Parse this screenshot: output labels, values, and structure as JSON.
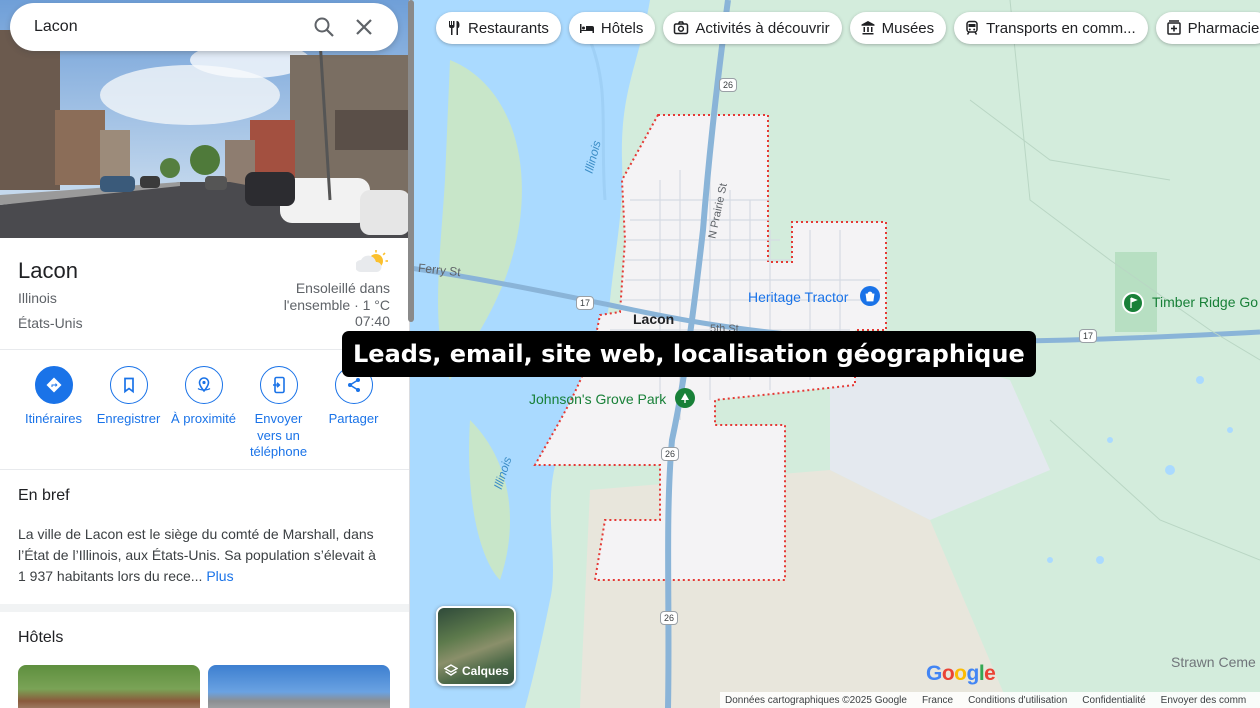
{
  "search": {
    "value": "Lacon"
  },
  "place": {
    "name": "Lacon",
    "state": "Illinois",
    "country": "États-Unis",
    "weather_line1": "Ensoleillé dans",
    "weather_line2": "l'ensemble · 1 °C",
    "time": "07:40"
  },
  "actions": [
    {
      "label": "Itinéraires",
      "icon": "directions-icon"
    },
    {
      "label": "Enregistrer",
      "icon": "bookmark-icon"
    },
    {
      "label": "À proximité",
      "icon": "nearby-icon"
    },
    {
      "label": "Envoyer vers un téléphone",
      "icon": "send-to-phone-icon"
    },
    {
      "label": "Partager",
      "icon": "share-icon"
    }
  ],
  "overview": {
    "title": "En bref",
    "text": "La ville de Lacon est le siège du comté de Marshall, dans l’État de l’Illinois, aux États-Unis. Sa population s’élevait à 1 937 habitants lors du rece...",
    "more": "Plus"
  },
  "hotels": {
    "title": "Hôtels"
  },
  "chips": [
    {
      "label": "Restaurants",
      "icon": "restaurant-icon"
    },
    {
      "label": "Hôtels",
      "icon": "bed-icon"
    },
    {
      "label": "Activités à découvrir",
      "icon": "camera-icon"
    },
    {
      "label": "Musées",
      "icon": "museum-icon"
    },
    {
      "label": "Transports en comm...",
      "icon": "train-icon"
    },
    {
      "label": "Pharmacie",
      "icon": "pharmacy-icon"
    }
  ],
  "map": {
    "town_label": "Lacon",
    "street_ferry": "Ferry St",
    "street_prairie": "N Prairie St",
    "street_5th": "5th St",
    "river_label_1": "Illinois",
    "river_label_2": "Illinois",
    "poi_tractor": "Heritage Tractor",
    "poi_park": "Johnson's Grove Park",
    "poi_timber": "Timber Ridge Go",
    "place_strawn": "Strawn Ceme",
    "route_26": "26",
    "route_17": "17",
    "layers_label": "Calques",
    "logo": "Google",
    "colors": {
      "water": "#aadaff",
      "land": "#d3ecdc",
      "town": "#f4f3f5",
      "road": "#8ab4d8",
      "boundary": "#e53935",
      "accent": "#1a73e8"
    }
  },
  "footer": {
    "attribution": "Données cartographiques ©2025 Google",
    "country": "France",
    "terms": "Conditions d'utilisation",
    "privacy": "Confidentialité",
    "feedback": "Envoyer des comm"
  },
  "banner": "Leads, email, site web, localisation géographique"
}
